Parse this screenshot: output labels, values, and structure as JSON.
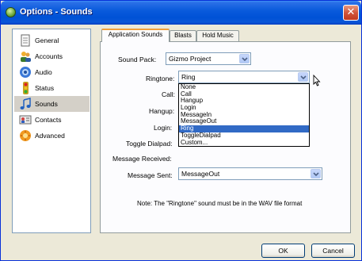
{
  "window": {
    "title": "Options - Sounds"
  },
  "sidebar": {
    "items": [
      {
        "label": "General",
        "icon": "document-icon"
      },
      {
        "label": "Accounts",
        "icon": "users-icon"
      },
      {
        "label": "Audio",
        "icon": "speaker-icon"
      },
      {
        "label": "Status",
        "icon": "traffic-light-icon"
      },
      {
        "label": "Sounds",
        "icon": "music-note-icon",
        "active": true
      },
      {
        "label": "Contacts",
        "icon": "contact-card-icon"
      },
      {
        "label": "Advanced",
        "icon": "advanced-icon"
      }
    ]
  },
  "tabs": [
    {
      "label": "Application Sounds",
      "active": true
    },
    {
      "label": "Blasts"
    },
    {
      "label": "Hold Music"
    }
  ],
  "form": {
    "sound_pack_label": "Sound Pack:",
    "sound_pack_value": "Gizmo Project",
    "ringtone_label": "Ringtone:",
    "ringtone_value": "Ring",
    "call_label": "Call:",
    "hangup_label": "Hangup:",
    "login_label": "Login:",
    "toggle_dialpad_label": "Toggle Dialpad:",
    "message_received_label": "Message Received:",
    "message_sent_label": "Message Sent:",
    "message_sent_value": "MessageOut"
  },
  "dropdown_options": [
    "None",
    "Call",
    "Hangup",
    "Login",
    "MessageIn",
    "MessageOut",
    "Ring",
    "ToggleDialpad",
    "Custom..."
  ],
  "dropdown_selected_index": 6,
  "note": "Note: The \"Ringtone\" sound must be in the WAV file format",
  "buttons": {
    "ok": "OK",
    "cancel": "Cancel"
  },
  "colors": {
    "selection": "#316ac5",
    "titlebar": "#0052d6",
    "tab_highlight": "#f1a03a"
  }
}
